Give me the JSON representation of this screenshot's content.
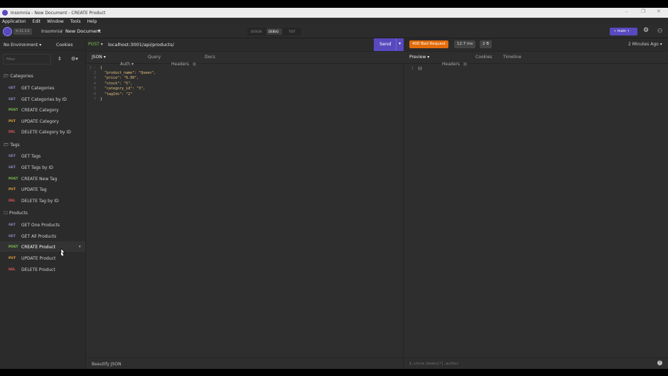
{
  "window": {
    "title": "Insomnia - New Document - CREATE Product",
    "controls": [
      "–",
      "❐",
      "✕"
    ]
  },
  "menu": [
    "Application",
    "Edit",
    "Window",
    "Tools",
    "Help"
  ],
  "toolbar": {
    "plan_badge": "21.3.0",
    "breadcrumb_root": "Insomnia",
    "breadcrumb_sep": "/",
    "breadcrumb_doc": "New Document",
    "modes": [
      "DESIGN",
      "DEBUG",
      "TEST"
    ],
    "active_mode": "DEBUG",
    "branch": "main"
  },
  "sidebar": {
    "environment": "No Environment",
    "cookies": "Cookies",
    "filter_placeholder": "Filter",
    "folders": [
      {
        "name": "Categories",
        "requests": [
          {
            "method": "GET",
            "name": "GET Categories"
          },
          {
            "method": "GET",
            "name": "GET Categories by ID"
          },
          {
            "method": "POST",
            "name": "CREATE Category"
          },
          {
            "method": "PUT",
            "name": "UPDATE Category"
          },
          {
            "method": "DEL",
            "name": "DELETE Category by ID"
          }
        ]
      },
      {
        "name": "Tags",
        "requests": [
          {
            "method": "GET",
            "name": "GET Tags"
          },
          {
            "method": "GET",
            "name": "GET Tags by ID"
          },
          {
            "method": "POST",
            "name": "CREATE New Tag"
          },
          {
            "method": "PUT",
            "name": "UPDATE Tag"
          },
          {
            "method": "DEL",
            "name": "DELETE Tag by ID"
          }
        ]
      },
      {
        "name": "Products",
        "requests": [
          {
            "method": "GET",
            "name": "GET One Products"
          },
          {
            "method": "GET",
            "name": "GET All Products"
          },
          {
            "method": "POST",
            "name": "CREATE Product"
          },
          {
            "method": "PUT",
            "name": "UPDATE Product"
          },
          {
            "method": "DEL",
            "name": "DELETE Product"
          }
        ]
      }
    ],
    "active_request": "CREATE Product"
  },
  "request": {
    "method": "POST",
    "url": "localhost:3001/api/products/",
    "send_label": "Send",
    "tabs": [
      "JSON",
      "Auth",
      "Query",
      "Headers",
      "Docs"
    ],
    "headers_count": "0",
    "body_lines": [
      "{",
      "  \"product_name\": \"Queen\",",
      "  \"price\": \"6.99\",",
      "  \"stock\": \"5\",",
      "  \"category_id\": \"3\",",
      "  \"tagIds\": \"2\"",
      "}"
    ],
    "footer_label": "Beautify JSON"
  },
  "response": {
    "status": "400 Bad Request",
    "time": "12.7 ms",
    "size": "2 B",
    "age": "2 Minutes Ago",
    "tabs": [
      "Preview",
      "Headers",
      "Cookies",
      "Timeline"
    ],
    "headers_count": "0",
    "body_lines": [
      "{}"
    ],
    "filter_placeholder": "$.store.books[*].author"
  },
  "colors": {
    "accent": "#5849be",
    "get": "#8a8dc5",
    "post": "#7bc74d",
    "put": "#e8a33c",
    "del": "#e35757",
    "error": "#e36c0a"
  }
}
